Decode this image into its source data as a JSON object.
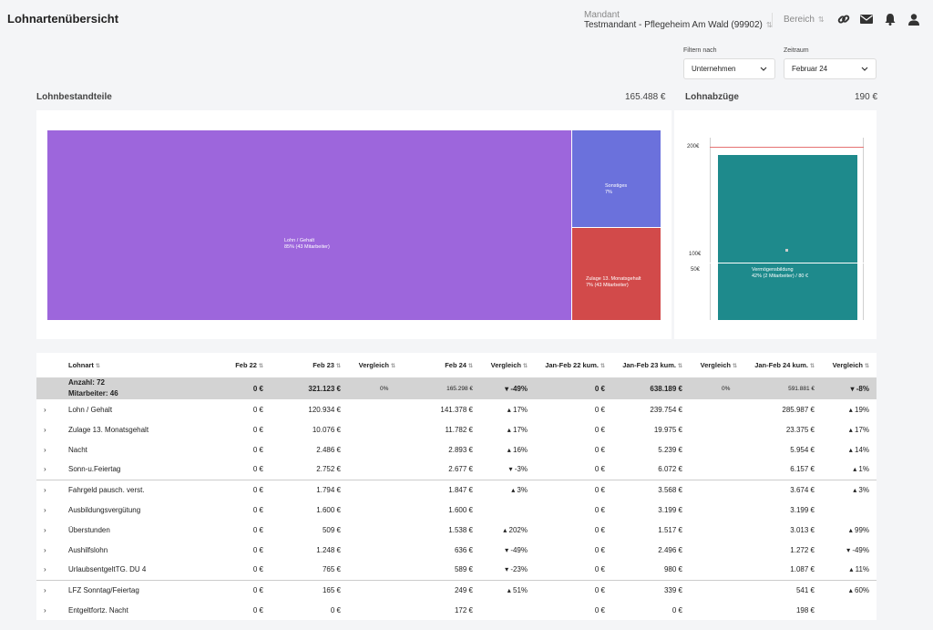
{
  "header": {
    "title": "Lohnartenübersicht",
    "mandant_label": "Mandant",
    "mandant_value": "Testmandant - Pflegeheim Am Wald (99902)",
    "bereich_label": "Bereich",
    "sort_glyph": "⇅"
  },
  "icons": [
    "link-icon",
    "mail-icon",
    "bell-icon",
    "user-icon"
  ],
  "filters": {
    "filter_label": "Filtern nach",
    "filter_value": "Unternehmen",
    "zeitraum_label": "Zeitraum",
    "zeitraum_value": "Februar 24"
  },
  "lohnbestandteile": {
    "title": "Lohnbestandteile",
    "total": "165.488 €",
    "treemap": [
      {
        "name": "Lohn / Gehalt",
        "sub": "85% (43 Mitarbeiter)",
        "color": "#9d66dc"
      },
      {
        "name": "Sonstiges",
        "sub": "7%",
        "color": "#6b71dc"
      },
      {
        "name": "Zulage 13. Monatsgehalt",
        "sub": "7% (43 Mitarbeiter)",
        "color": "#d24a4a"
      }
    ]
  },
  "lohnabzuege": {
    "title": "Lohnabzüge",
    "total": "190 €",
    "chart_data": {
      "type": "bar",
      "categories": [
        "Vermögensbildung"
      ],
      "series": [
        {
          "name": "Vermögensbildung",
          "values": [
            190
          ]
        }
      ],
      "label": "Vermögensbildung",
      "sub": "42% (2 Mitarbeiter) / 80 €",
      "ticks": [
        "200€",
        "100€",
        "50€"
      ],
      "ylim": [
        0,
        200
      ],
      "color": "#1e8a8c"
    }
  },
  "table": {
    "headers": [
      "Lohnart",
      "Feb 22",
      "Feb 23",
      "Vergleich",
      "Feb 24",
      "Vergleich",
      "Jan-Feb 22 kum.",
      "Jan-Feb 23 kum.",
      "Vergleich",
      "Jan-Feb 24 kum.",
      "Vergleich"
    ],
    "summary": {
      "anzahl": "Anzahl: 72",
      "mitarbeiter": "Mitarbeiter: 46",
      "cells": [
        "0 €",
        "321.123 €",
        "0%",
        "165.298 €",
        "▾ -49%",
        "0 €",
        "638.189 €",
        "0%",
        "591.881 €",
        "▾ -8%"
      ]
    },
    "rows": [
      {
        "name": "Lohn / Gehalt",
        "cells": [
          "0 €",
          "120.934 €",
          "",
          "141.378 €",
          "▴ 17%",
          "0 €",
          "239.754 €",
          "",
          "285.987 €",
          "▴ 19%"
        ]
      },
      {
        "name": "Zulage 13. Monatsgehalt",
        "cells": [
          "0 €",
          "10.076 €",
          "",
          "11.782 €",
          "▴ 17%",
          "0 €",
          "19.975 €",
          "",
          "23.375 €",
          "▴ 17%"
        ]
      },
      {
        "name": "Nacht",
        "cells": [
          "0 €",
          "2.486 €",
          "",
          "2.893 €",
          "▴ 16%",
          "0 €",
          "5.239 €",
          "",
          "5.954 €",
          "▴ 14%"
        ]
      },
      {
        "name": "Sonn-u.Feiertag",
        "cells": [
          "0 €",
          "2.752 €",
          "",
          "2.677 €",
          "▾ -3%",
          "0 €",
          "6.072 €",
          "",
          "6.157 €",
          "▴ 1%"
        ]
      },
      {
        "name": "Fahrgeld pausch. verst.",
        "cells": [
          "0 €",
          "1.794 €",
          "",
          "1.847 €",
          "▴ 3%",
          "0 €",
          "3.568 €",
          "",
          "3.674 €",
          "▴ 3%"
        ],
        "sep": true
      },
      {
        "name": "Ausbildungsvergütung",
        "cells": [
          "0 €",
          "1.600 €",
          "",
          "1.600 €",
          "",
          "0 €",
          "3.199 €",
          "",
          "3.199 €",
          ""
        ]
      },
      {
        "name": "Überstunden",
        "cells": [
          "0 €",
          "509 €",
          "",
          "1.538 €",
          "▴ 202%",
          "0 €",
          "1.517 €",
          "",
          "3.013 €",
          "▴ 99%"
        ]
      },
      {
        "name": "Aushilfslohn",
        "cells": [
          "0 €",
          "1.248 €",
          "",
          "636 €",
          "▾ -49%",
          "0 €",
          "2.496 €",
          "",
          "1.272 €",
          "▾ -49%"
        ]
      },
      {
        "name": "UrlaubsentgeltTG. DU 4",
        "cells": [
          "0 €",
          "765 €",
          "",
          "589 €",
          "▾ -23%",
          "0 €",
          "980 €",
          "",
          "1.087 €",
          "▴ 11%"
        ]
      },
      {
        "name": "LFZ Sonntag/Feiertag",
        "cells": [
          "0 €",
          "165 €",
          "",
          "249 €",
          "▴ 51%",
          "0 €",
          "339 €",
          "",
          "541 €",
          "▴ 60%"
        ],
        "sep": true
      },
      {
        "name": "Entgeltfortz. Nacht",
        "cells": [
          "0 €",
          "0 €",
          "",
          "172 €",
          "",
          "0 €",
          "0 €",
          "",
          "198 €",
          ""
        ]
      }
    ]
  }
}
